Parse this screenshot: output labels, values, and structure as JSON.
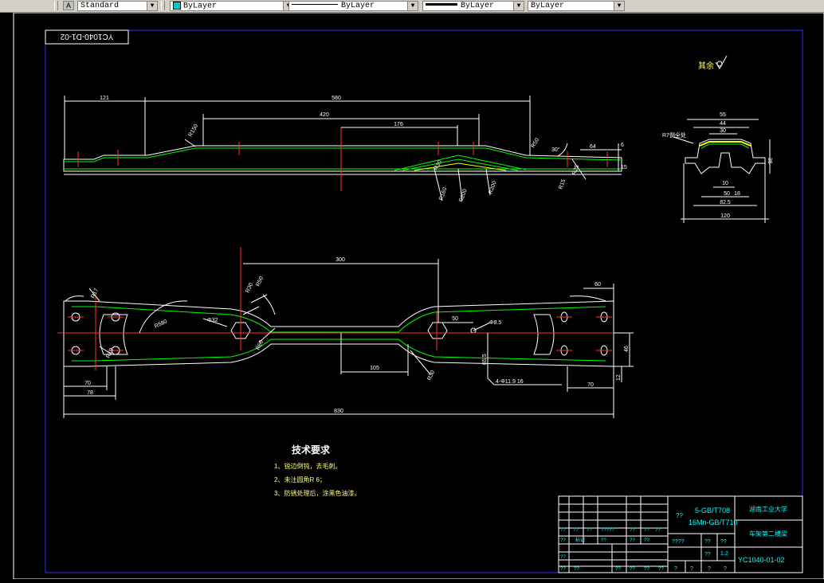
{
  "toolbar": {
    "text_style": "Standard",
    "color": "ByLayer",
    "linetype": "ByLayer",
    "lineweight": "ByLayer",
    "plotstyle": "ByLayer"
  },
  "drawing": {
    "drawing_code_top": "YC1040-D1-02",
    "roughness_note": "其余",
    "dims_side": {
      "d121": "121",
      "d580": "580",
      "d420": "420",
      "d176": "176",
      "d30deg": "30°",
      "d64": "64",
      "d6": "6",
      "d5": "5",
      "d15": "15",
      "r150": "R150",
      "r160": "R160",
      "r200a": "R200",
      "r200b": "R200",
      "r25": "R25",
      "r50": "R50",
      "r30": "R30",
      "r15": "R15",
      "d14": "14"
    },
    "dims_section": {
      "d55": "55",
      "d44": "44",
      "d30": "30",
      "d10": "10",
      "d18": "18",
      "d50": "50",
      "d82_5": "82.5",
      "d120": "120",
      "d35": "35",
      "r7": "R7倒全处"
    },
    "dims_plan": {
      "d300": "300",
      "d60": "60",
      "d50": "50",
      "d105": "105",
      "d70a": "70",
      "d78": "78",
      "d830": "830",
      "d70b": "70",
      "d46": "46",
      "d12": "12",
      "d65_5": "65.5",
      "phi32": "Φ32",
      "phi8_5": "Φ8.5",
      "r30": "R30",
      "r50": "R50",
      "r19": "R19",
      "r17": "R17",
      "r580": "R580",
      "r30b": "R30",
      "r60": "R60",
      "holes": "4-Φ11.9 16"
    },
    "tech_req": {
      "title": "技术要求",
      "items": [
        "1、锐边倒钝，去毛刺。",
        "2、未注圆角R 6；",
        "3、防锈处理后，涂黑色油漆。"
      ]
    },
    "title_block": {
      "material1": "5-GB/T708",
      "material2": "16Mn-GB/T710",
      "school": "湖南工业大学",
      "part_name": "车架第二横梁",
      "drawing_no": "YC1040-01-02",
      "scale": "1:2",
      "q1": "??",
      "q2": "??",
      "q3": "??",
      "q4": "?????",
      "q5": "??",
      "q6": "????",
      "q7": "??",
      "q8": "??",
      "q9": "??",
      "q10": "?",
      "q11": "?",
      "q12": "?",
      "q13": "?",
      "q14": "??",
      "q15": "??",
      "q16": "??",
      "q17": "??",
      "q18": "??",
      "q19": "??",
      "q20": "??",
      "q21": "??",
      "q22": "??",
      "q23": "??",
      "q24": "??",
      "q25": "??",
      "q26": "??",
      "q27": "标记",
      "q28": "??"
    }
  }
}
